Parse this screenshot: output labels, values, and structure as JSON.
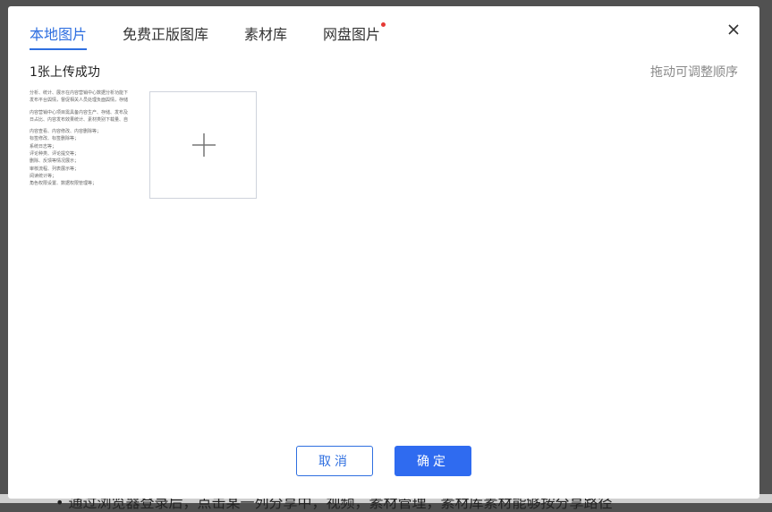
{
  "dialog": {
    "tabs": [
      {
        "label": "本地图片",
        "active": true
      },
      {
        "label": "免费正版图库",
        "active": false
      },
      {
        "label": "素材库",
        "active": false
      },
      {
        "label": "网盘图片",
        "active": false,
        "notification_dot": true
      }
    ],
    "upload_status": "1张上传成功",
    "reorder_hint": "拖动可调整顺序",
    "thumbnail_lines": [
      "分析、统计、展示在内容营销中心数据分析功能下",
      "发布平台舆情，督促相关人员处理负面舆情，存储",
      "",
      "内容营销中心项目需具备内容生产、存储、发布及",
      "日占比、内容发布效果统计、素材类别下载量、自",
      "",
      "内容查看、内容修改、内容删除等；",
      "标签修改、标签删除等；",
      "系统日志等；",
      "评论种类、评论提交等；",
      "删除、反馈等情况展示；",
      "审核流程、列表展示等；",
      "阅读统计等；",
      "角色权限设置、数据权限管理等；"
    ],
    "cancel_label": "取消",
    "confirm_label": "确定",
    "icons": {
      "close": "close-icon",
      "add": "plus-icon"
    }
  },
  "background": {
    "partial_text": "• 通过浏览器登录后，点击某一列分享中，视频，素材管理，素材库素材能够按分享路径"
  },
  "colors": {
    "accent": "#2f6fe0",
    "primary_button": "#2f6bf0",
    "notification": "#e53935",
    "overlay": "#515151"
  }
}
